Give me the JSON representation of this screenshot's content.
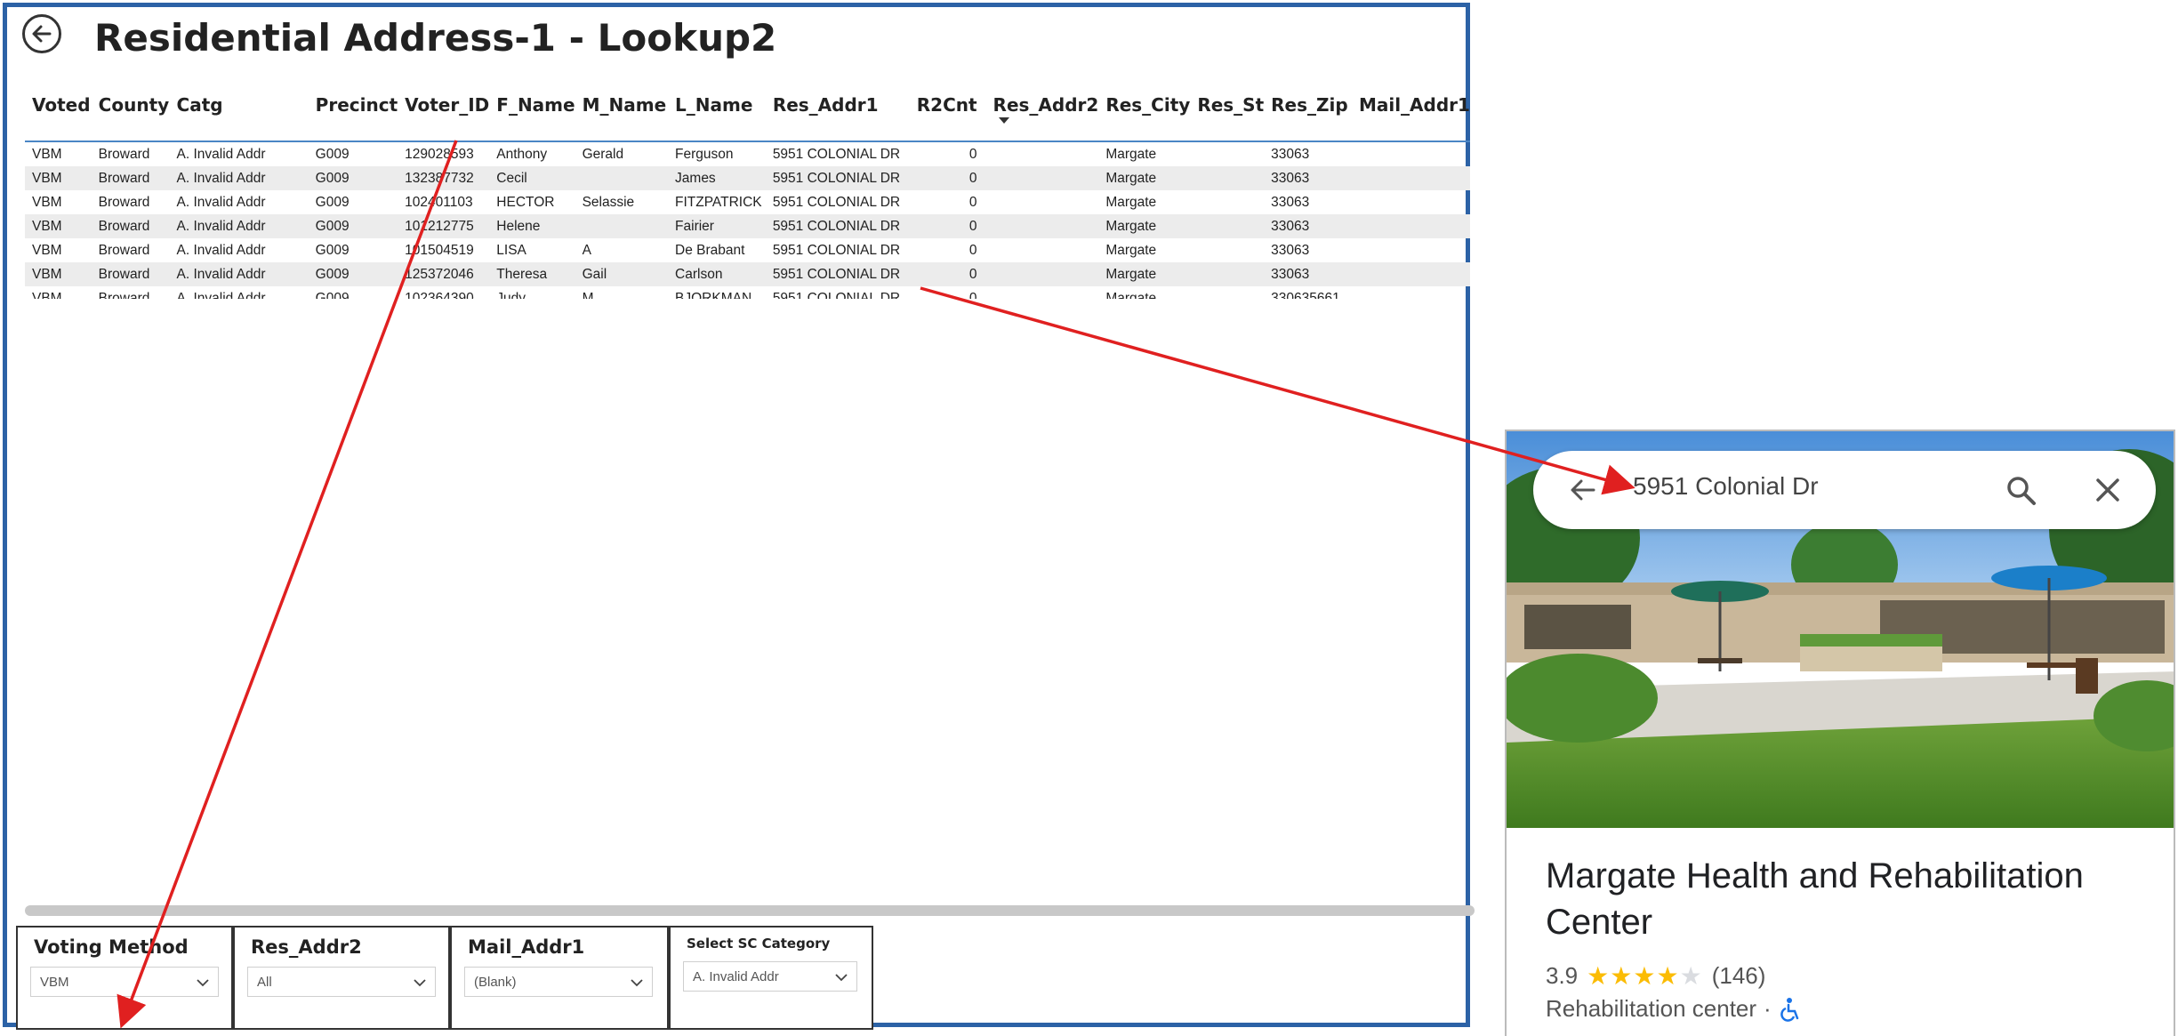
{
  "report": {
    "title": "Residential Address-1 - Lookup2",
    "columns": [
      "Voted",
      "County",
      "Catg",
      "Precinct",
      "Voter_ID",
      "F_Name",
      "M_Name",
      "L_Name",
      "Res_Addr1",
      "R2Cnt",
      "Res_Addr2",
      "Res_City",
      "Res_St",
      "Res_Zip",
      "Mail_Addr1"
    ],
    "sorted_column": "Res_Addr2",
    "rows": [
      [
        "VBM",
        "Broward",
        "A. Invalid Addr",
        "G009",
        "129028593",
        "Anthony",
        "Gerald",
        "Ferguson",
        "5951 COLONIAL DR",
        "0",
        "",
        "Margate",
        "",
        "33063",
        ""
      ],
      [
        "VBM",
        "Broward",
        "A. Invalid Addr",
        "G009",
        "132387732",
        "Cecil",
        "",
        "James",
        "5951 COLONIAL DR",
        "0",
        "",
        "Margate",
        "",
        "33063",
        ""
      ],
      [
        "VBM",
        "Broward",
        "A. Invalid Addr",
        "G009",
        "102401103",
        "HECTOR",
        "Selassie",
        "FITZPATRICK",
        "5951 COLONIAL DR",
        "0",
        "",
        "Margate",
        "",
        "33063",
        ""
      ],
      [
        "VBM",
        "Broward",
        "A. Invalid Addr",
        "G009",
        "101212775",
        "Helene",
        "",
        "Fairier",
        "5951 COLONIAL DR",
        "0",
        "",
        "Margate",
        "",
        "33063",
        ""
      ],
      [
        "VBM",
        "Broward",
        "A. Invalid Addr",
        "G009",
        "101504519",
        "LISA",
        "A",
        "De Brabant",
        "5951 COLONIAL DR",
        "0",
        "",
        "Margate",
        "",
        "33063",
        ""
      ],
      [
        "VBM",
        "Broward",
        "A. Invalid Addr",
        "G009",
        "125372046",
        "Theresa",
        "Gail",
        "Carlson",
        "5951 COLONIAL DR",
        "0",
        "",
        "Margate",
        "",
        "33063",
        ""
      ],
      [
        "VBM",
        "Broward",
        "A. Invalid Addr",
        "G009",
        "102364390",
        "Judy",
        "M",
        "BJORKMAN",
        "5951 COLONIAL DR",
        "0",
        "",
        "Margate",
        "",
        "330635661",
        ""
      ]
    ],
    "slicers": [
      {
        "title": "Voting Method",
        "value": "VBM"
      },
      {
        "title": "Res_Addr2",
        "value": "All"
      },
      {
        "title": "Mail_Addr1",
        "value": "(Blank)"
      },
      {
        "title": "Select SC Category",
        "value": "A. Invalid Addr"
      }
    ]
  },
  "maps": {
    "search_text": "5951 Colonial Dr",
    "place_name": "Margate Health and Rehabilitation Center",
    "rating": "3.9",
    "rating_value": 3.9,
    "review_count": "(146)",
    "category": "Rehabilitation center",
    "separator": "·",
    "icons": [
      "back-arrow-icon",
      "search-icon",
      "close-icon",
      "star-icon",
      "wheelchair-icon"
    ]
  },
  "colors": {
    "accent": "#2c62a6",
    "arrow": "#e02020",
    "star": "#fbbc04",
    "accessibility": "#1a73e8"
  }
}
